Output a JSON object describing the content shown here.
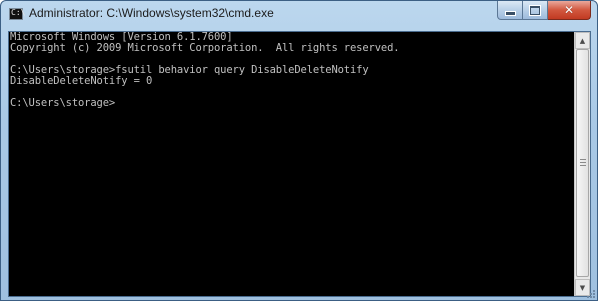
{
  "window": {
    "title": "Administrator: C:\\Windows\\system32\\cmd.exe",
    "app_icon": "cmd-icon",
    "app_icon_glyph": "C:\\",
    "buttons": {
      "minimize": "minimize-icon",
      "maximize": "maximize-icon",
      "close": "close-icon",
      "close_glyph": "✕"
    }
  },
  "console": {
    "lines": [
      "Microsoft Windows [Version 6.1.7600]",
      "Copyright (c) 2009 Microsoft Corporation.  All rights reserved.",
      "",
      "C:\\Users\\storage>fsutil behavior query DisableDeleteNotify",
      "DisableDeleteNotify = 0",
      "",
      "C:\\Users\\storage>"
    ],
    "foreground": "#c0c0c0",
    "background": "#000000"
  },
  "scrollbar": {
    "up_glyph": "▲",
    "down_glyph": "▼"
  }
}
